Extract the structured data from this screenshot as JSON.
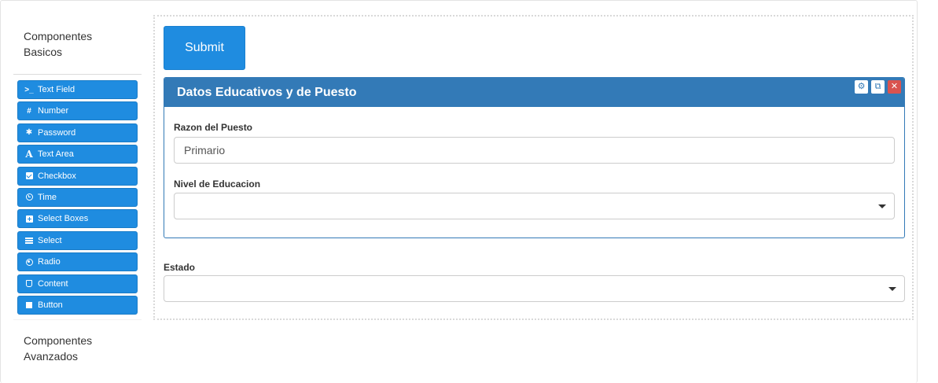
{
  "sidebar": {
    "basic_title": "Componentes Basicos",
    "advanced_title": "Componentes Avanzados",
    "components": [
      {
        "label": "Text Field",
        "icon": "terminal-icon"
      },
      {
        "label": "Number",
        "icon": "hash-icon"
      },
      {
        "label": "Password",
        "icon": "asterisk-icon"
      },
      {
        "label": "Text Area",
        "icon": "font-icon"
      },
      {
        "label": "Checkbox",
        "icon": "check-square-icon"
      },
      {
        "label": "Time",
        "icon": "clock-icon"
      },
      {
        "label": "Select Boxes",
        "icon": "plus-square-icon"
      },
      {
        "label": "Select",
        "icon": "list-icon"
      },
      {
        "label": "Radio",
        "icon": "dot-circle-icon"
      },
      {
        "label": "Content",
        "icon": "html5-icon"
      },
      {
        "label": "Button",
        "icon": "stop-icon"
      }
    ]
  },
  "builder": {
    "submit_label": "Submit",
    "panel": {
      "title": "Datos Educativos y de Puesto",
      "fields": {
        "razon": {
          "label": "Razon del Puesto",
          "value": "Primario"
        },
        "nivel": {
          "label": "Nivel de Educacion",
          "value": ""
        }
      }
    },
    "estado": {
      "label": "Estado",
      "value": ""
    }
  },
  "colors": {
    "primary": "#1f8ce0",
    "panel_header": "#337ab7",
    "danger": "#d9534f"
  }
}
